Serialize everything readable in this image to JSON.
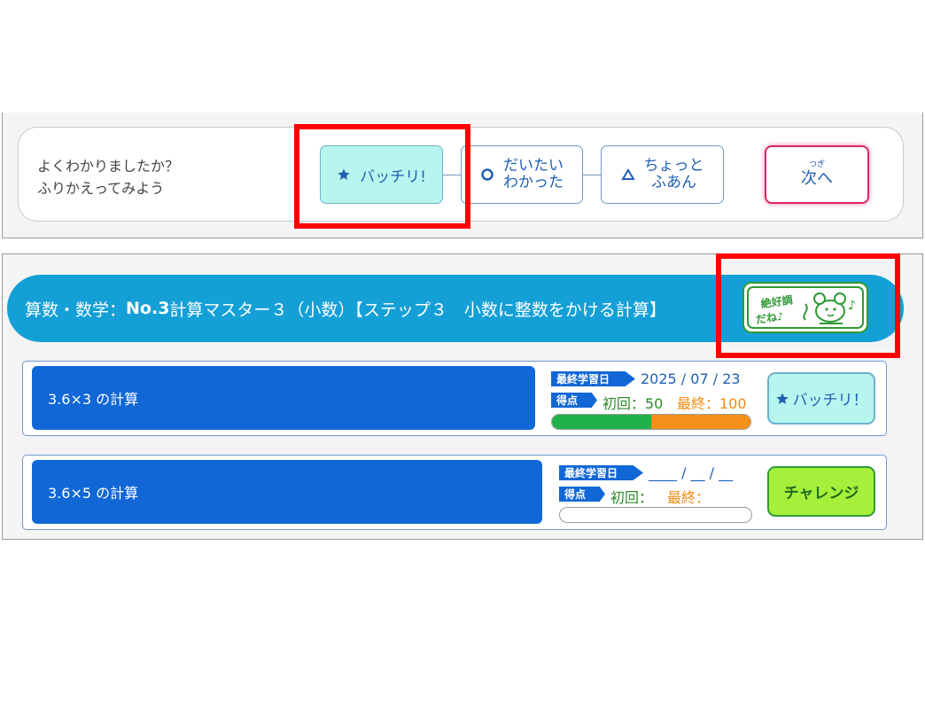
{
  "feedback": {
    "question_line1": "よくわかりましたか？",
    "question_line2": "ふりかえってみよう",
    "options": [
      {
        "label": "バッチリ!",
        "icon": "star-icon",
        "selected": true
      },
      {
        "label_line1": "だいたい",
        "label_line2": "わかった",
        "icon": "circle-icon"
      },
      {
        "label_line1": "ちょっと",
        "label_line2": "ふあん",
        "icon": "triangle-icon"
      }
    ],
    "next": {
      "ruby": "つぎ",
      "label": "次へ"
    }
  },
  "course": {
    "title_prefix": "算数・数学：",
    "title_bold": "No.3",
    "title_rest": "計算マスター３（小数）【ステップ３　小数に整数をかける計算】",
    "stamp_text_line1": "絶好調",
    "stamp_text_line2": "だね♪",
    "lessons": [
      {
        "title": "3.6×3 の計算",
        "last_study_label": "最終学習日",
        "last_study_date": "2025 / 07 / 23",
        "score_label": "得点",
        "first_score": "初回：50",
        "final_score": "最終：100",
        "first_progress": 0.5,
        "final_progress": 1.0,
        "action_label": "バッチリ！",
        "action_icon": "star-icon"
      },
      {
        "title": "3.6×5 の計算",
        "last_study_label": "最終学習日",
        "last_study_date": "____ / __ / __",
        "score_label": "得点",
        "first_score": "初回：",
        "final_score": "最終：",
        "first_progress": 0,
        "final_progress": 0,
        "action_label": "チャレンジ"
      }
    ]
  },
  "colors": {
    "accent_blue": "#1167d6",
    "header_blue": "#14a0d6",
    "highlight_red": "#ff0000",
    "next_border": "#e0246c",
    "progress_green": "#21b14a",
    "progress_orange": "#f5901a"
  }
}
